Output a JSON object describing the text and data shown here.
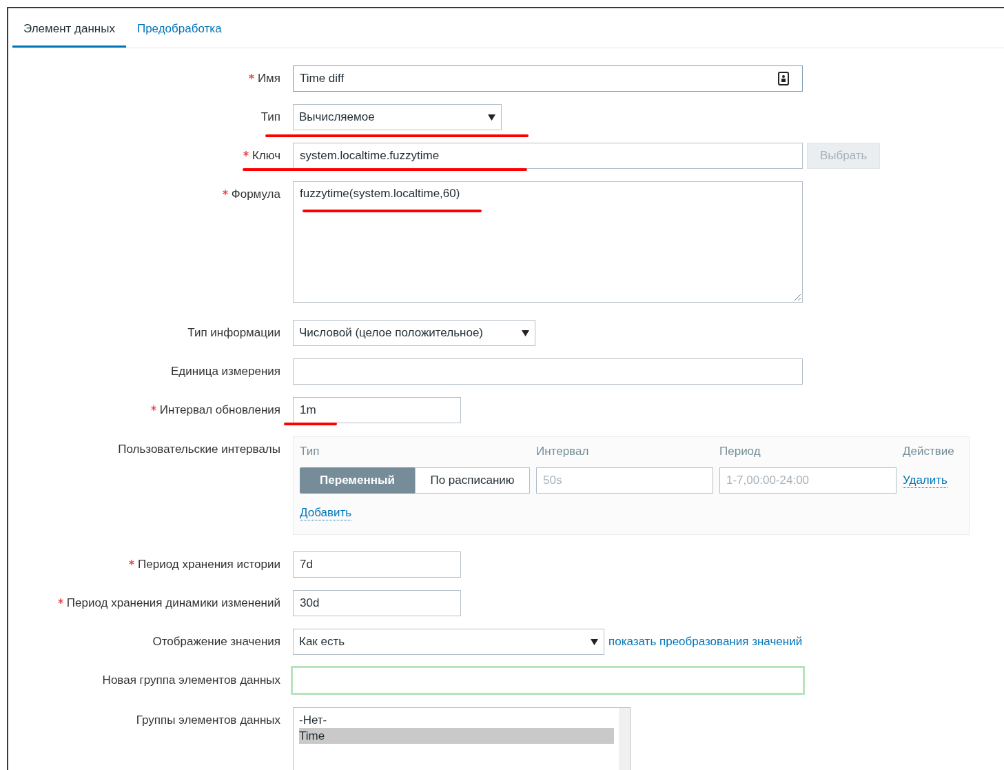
{
  "tabs": [
    {
      "label": "Элемент данных",
      "selected": true
    },
    {
      "label": "Предобработка",
      "selected": false
    }
  ],
  "fields": [
    {
      "kind": "text",
      "label": "Имя",
      "required": true,
      "value": "Time diff",
      "annotated": false
    },
    {
      "kind": "select",
      "label": "Тип",
      "required": false,
      "value": "Вычисляемое",
      "annotated": true
    },
    {
      "kind": "key",
      "label": "Ключ",
      "required": true,
      "value": "system.localtime.fuzzytime",
      "button": {
        "label": "Выбрать",
        "disabled": true
      },
      "annotated": true
    },
    {
      "kind": "textarea",
      "label": "Формула",
      "required": true,
      "value": "fuzzytime(system.localtime,60)",
      "annotated": true
    },
    {
      "kind": "select",
      "label": "Тип информации",
      "required": false,
      "value": "Числовой (целое положительное)",
      "annotated": false
    },
    {
      "kind": "text",
      "label": "Единица измерения",
      "required": false,
      "annotated": false
    },
    {
      "kind": "short",
      "label": "Интервал обновления",
      "required": true,
      "value": "1m",
      "annotated": true
    },
    {
      "kind": "intervals",
      "label": "Пользовательские интервалы",
      "required": false,
      "columns": [
        "Тип",
        "Интервал",
        "Период",
        "Действие"
      ],
      "rows": [
        {
          "modes": [
            {
              "label": "Переменный",
              "selected": true
            },
            {
              "label": "По расписанию",
              "selected": false
            }
          ],
          "interval_placeholder": "50s",
          "period_placeholder": "1-7,00:00-24:00",
          "action": "Удалить"
        }
      ],
      "add_link": "Добавить"
    },
    {
      "kind": "short",
      "label": "Период хранения истории",
      "required": true,
      "value": "7d",
      "annotated": false
    },
    {
      "kind": "short",
      "label": "Период хранения динамики изменений",
      "required": true,
      "value": "30d",
      "annotated": false
    },
    {
      "kind": "select",
      "label": "Отображение значения",
      "required": false,
      "value": "Как есть",
      "link": "показать преобразования значений",
      "annotated": false
    },
    {
      "kind": "text",
      "label": "Новая группа элементов данных",
      "required": false,
      "highlighted": true,
      "annotated": false
    },
    {
      "kind": "listbox",
      "label": "Группы элементов данных",
      "required": false,
      "items": [
        {
          "label": "-Нет-",
          "selected": false
        },
        {
          "label": "Time",
          "selected": true
        }
      ]
    }
  ]
}
